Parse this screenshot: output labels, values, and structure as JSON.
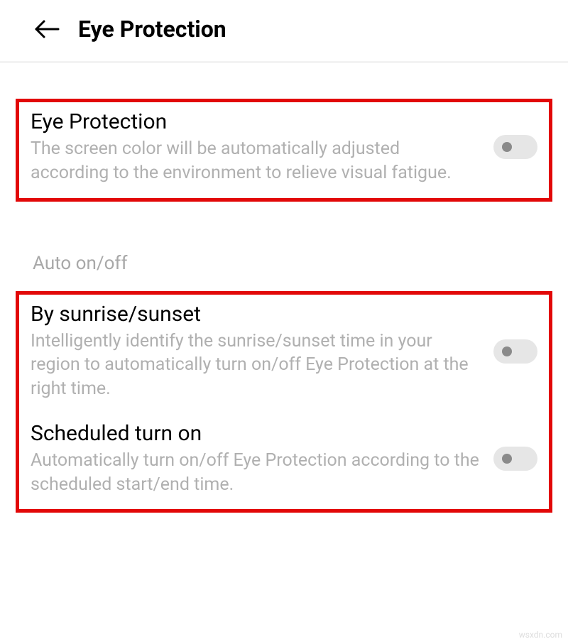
{
  "header": {
    "title": "Eye Protection"
  },
  "settings": {
    "eye_protection": {
      "title": "Eye Protection",
      "desc": "The screen color will be automatically adjusted according to the environment to relieve visual fatigue.",
      "enabled": false
    },
    "section_label": "Auto on/off",
    "by_sunrise": {
      "title": "By sunrise/sunset",
      "desc": "Intelligently identify the sunrise/sunset time in your region to automatically turn on/off Eye Protection at the right time.",
      "enabled": false
    },
    "scheduled": {
      "title": "Scheduled turn on",
      "desc": "Automatically turn on/off Eye Protection according to the scheduled start/end time.",
      "enabled": false
    }
  },
  "watermark": "wsxdn.com"
}
